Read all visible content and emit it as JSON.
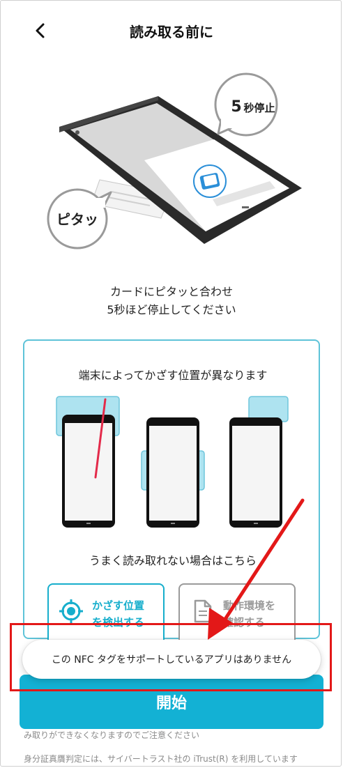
{
  "header": {
    "title": "読み取る前に"
  },
  "hero": {
    "bubble_stop_number": "5",
    "bubble_stop_text": "秒停止",
    "bubble_tap": "ピタッ"
  },
  "instructions": {
    "line1": "カードにピタッと合わせ",
    "line2": "5秒ほど停止してください"
  },
  "info_box": {
    "title": "端末によってかざす位置が異なります",
    "trouble_text": "うまく読み取れない場合はこちら",
    "detect_button": {
      "line1": "かざす位置",
      "line2": "を検出する"
    },
    "env_button": {
      "line1": "動作環境を",
      "line2": "確認する"
    }
  },
  "start_button": {
    "label": "開始"
  },
  "notes": {
    "line1": "み取りができなくなりますのでご注意ください",
    "line2": "身分証真贋判定には、サイバートラスト社の iTrust(R) を利用しています"
  },
  "toast": {
    "message": "この NFC タグをサポートしているアプリはありません"
  },
  "colors": {
    "accent": "#13b1d4",
    "annotation": "#e31818",
    "nfc_zone": "#aee3f0"
  }
}
